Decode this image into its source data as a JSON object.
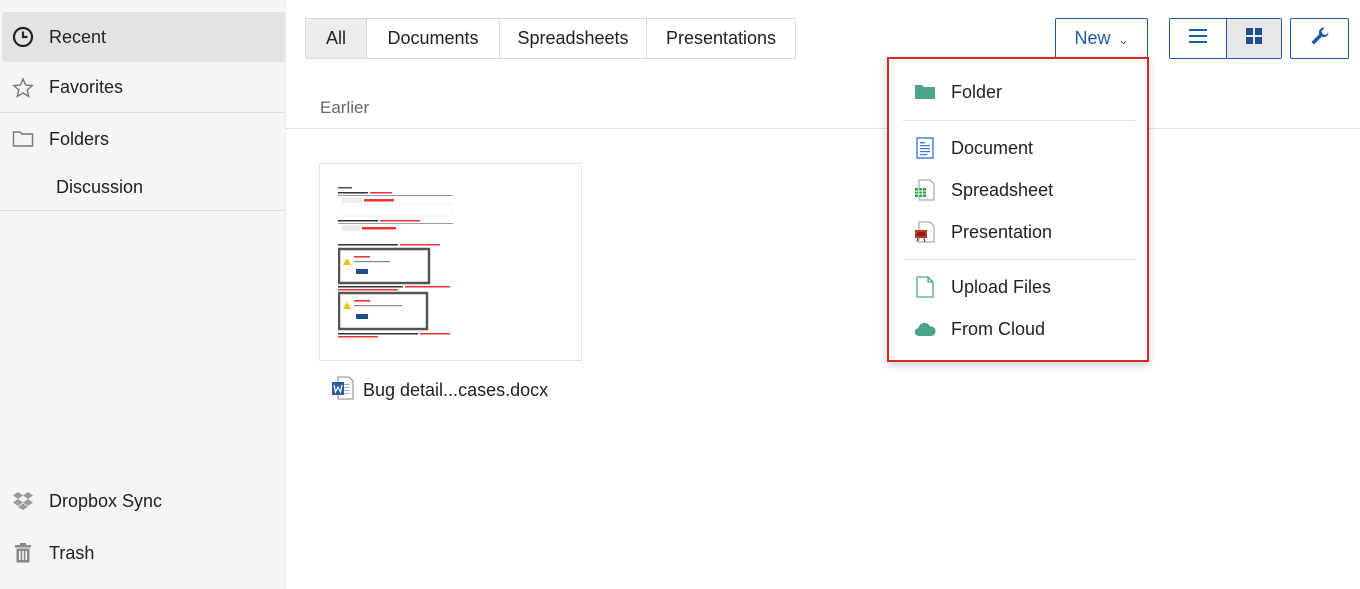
{
  "sidebar": {
    "items": [
      {
        "label": "Recent",
        "icon": "clock-icon"
      },
      {
        "label": "Favorites",
        "icon": "star-icon"
      },
      {
        "label": "Folders",
        "icon": "folder-outline-icon"
      },
      {
        "label": "Discussion"
      },
      {
        "label": "Dropbox Sync",
        "icon": "dropbox-icon"
      },
      {
        "label": "Trash",
        "icon": "trash-icon"
      }
    ]
  },
  "tabs": [
    {
      "label": "All",
      "active": true
    },
    {
      "label": "Documents"
    },
    {
      "label": "Spreadsheets"
    },
    {
      "label": "Presentations"
    }
  ],
  "toolbar": {
    "new_label": "New",
    "new_caret": "⌄",
    "list_view_icon": "list-icon",
    "grid_view_icon": "grid-icon",
    "tools_icon": "wrench-icon"
  },
  "section": {
    "heading": "Earlier"
  },
  "files": [
    {
      "name": "Bug detail...cases.docx",
      "icon": "word-doc-icon"
    }
  ],
  "new_menu": {
    "items": [
      {
        "label": "Folder",
        "icon": "folder-icon"
      },
      {
        "label": "Document",
        "icon": "document-icon"
      },
      {
        "label": "Spreadsheet",
        "icon": "spreadsheet-icon"
      },
      {
        "label": "Presentation",
        "icon": "presentation-icon"
      },
      {
        "label": "Upload Files",
        "icon": "upload-file-icon"
      },
      {
        "label": "From Cloud",
        "icon": "cloud-icon"
      }
    ]
  },
  "colors": {
    "accent": "#1f5aa6",
    "menu_highlight_border": "#e02424",
    "folder_green": "#4aa58c"
  }
}
